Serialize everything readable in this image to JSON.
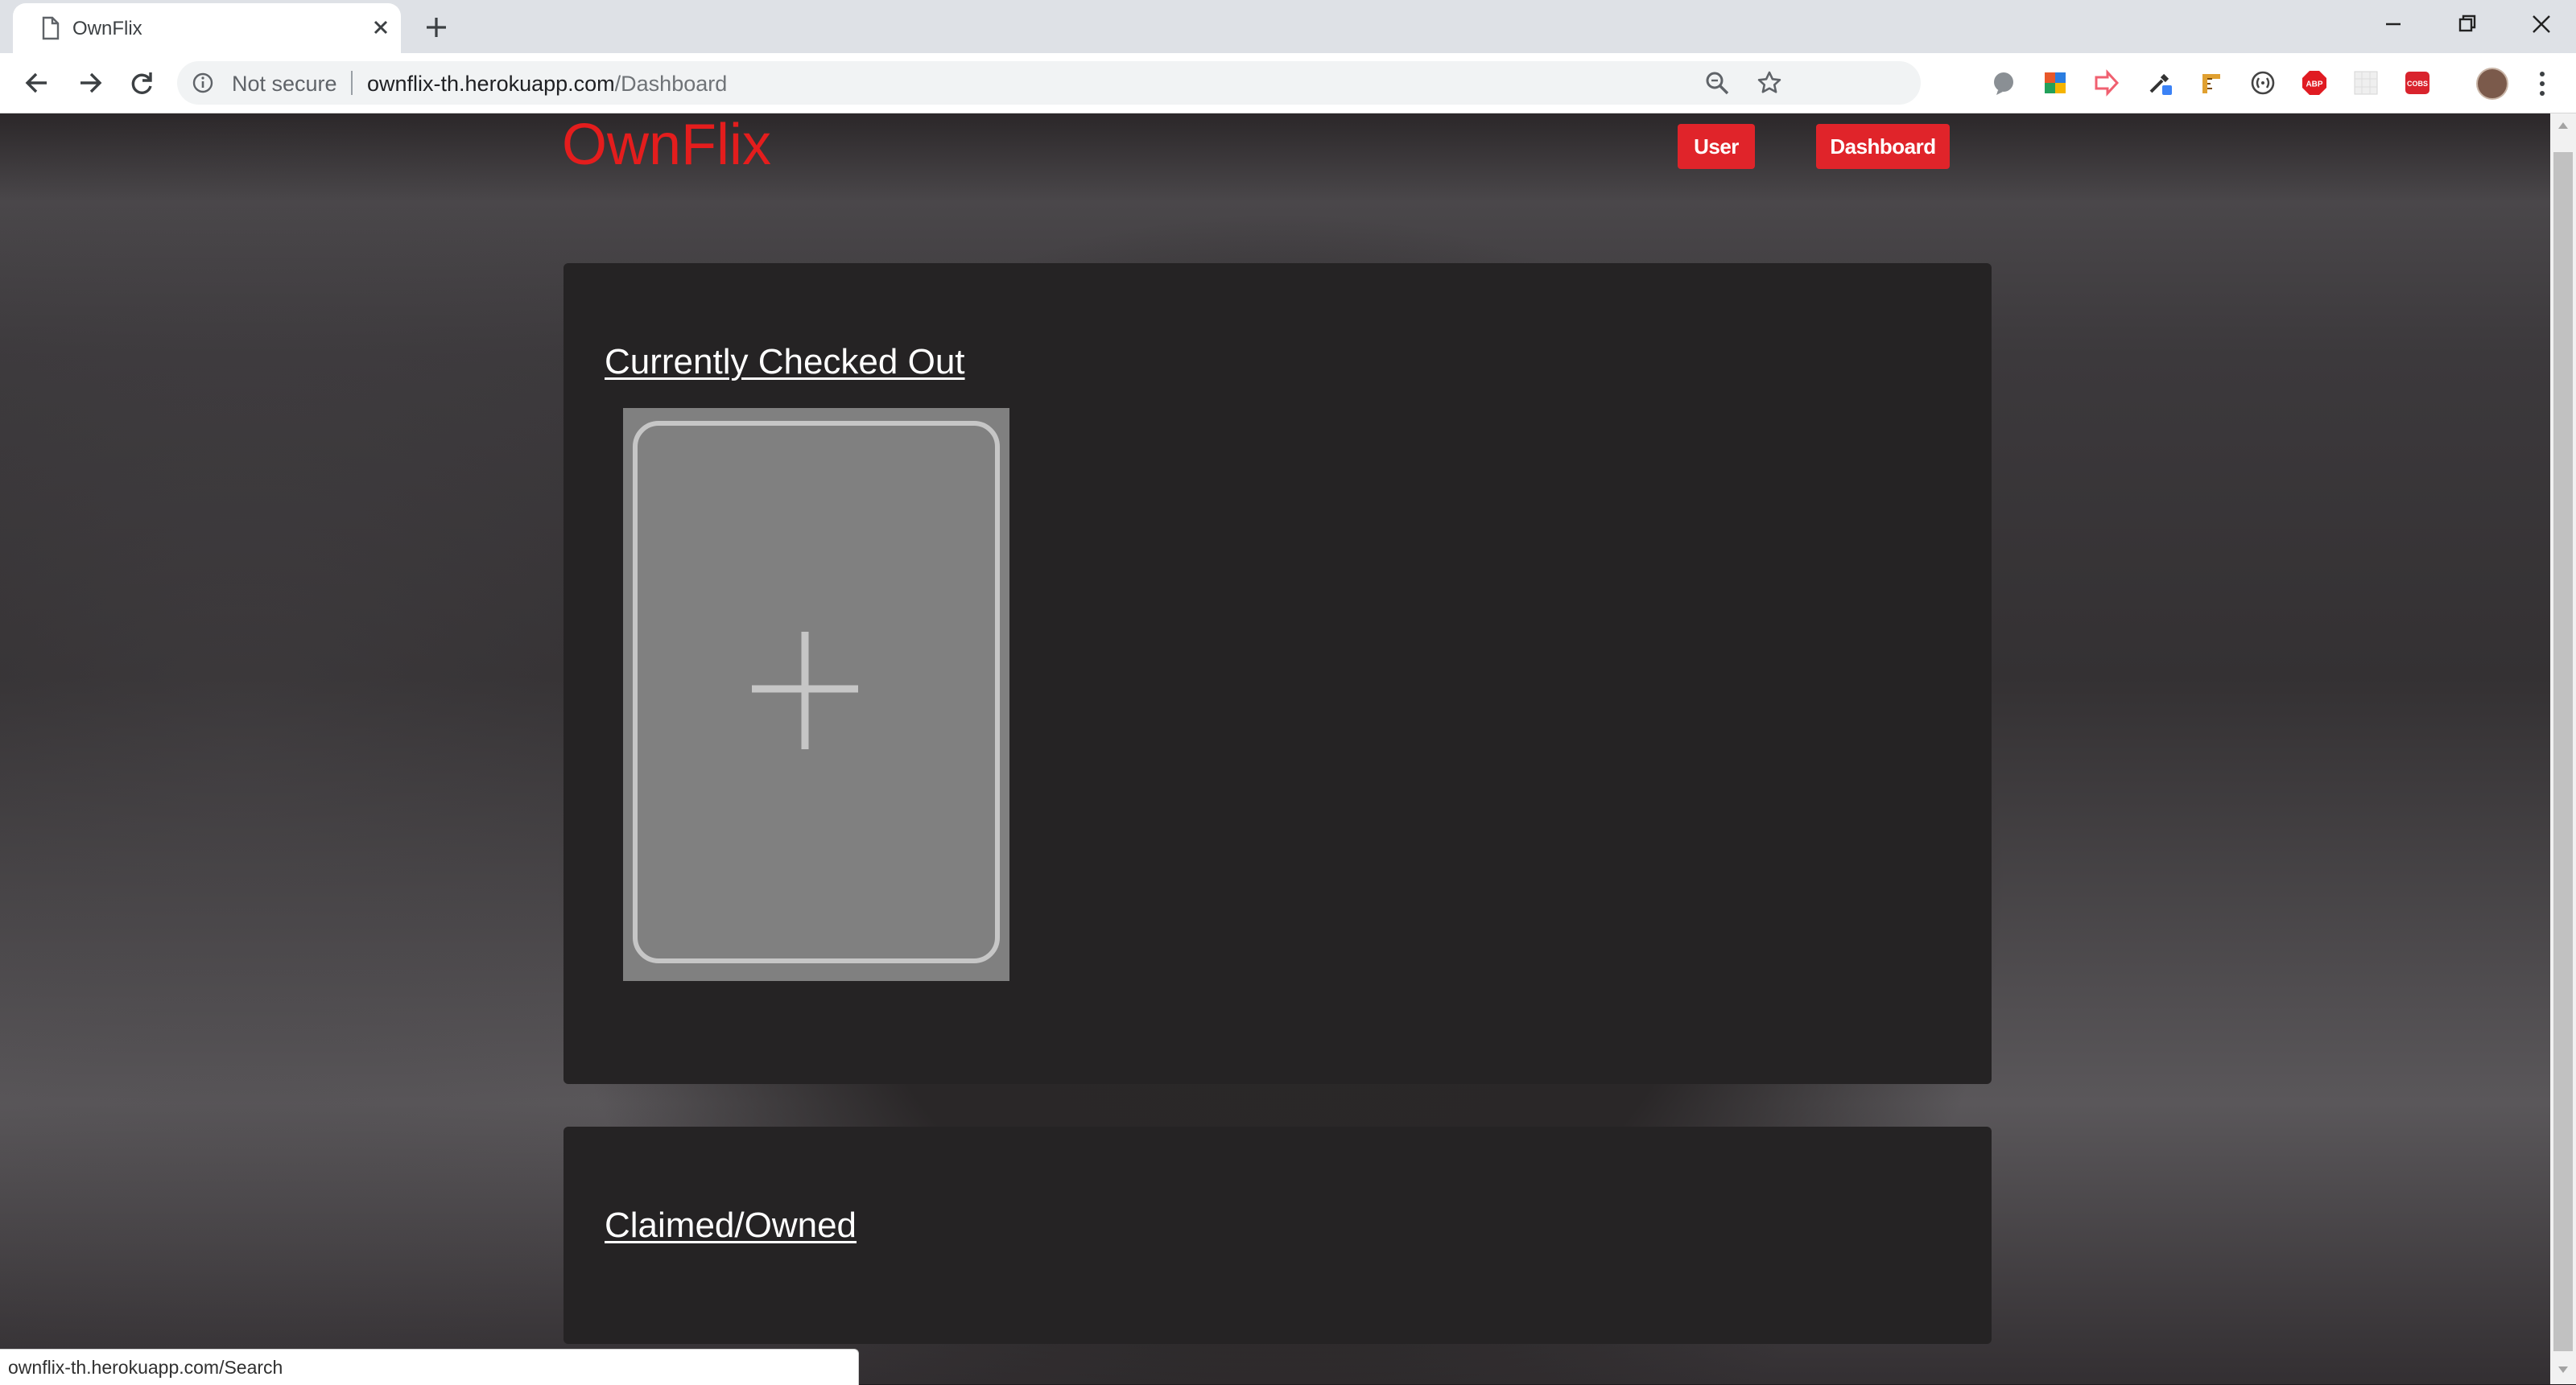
{
  "browser": {
    "tab_title": "OwnFlix",
    "security_label": "Not secure",
    "url_host": "ownflix-th.herokuapp.com",
    "url_path": "/Dashboard",
    "extensions": [
      {
        "name": "circle-ext-icon",
        "badge": ""
      },
      {
        "name": "colorful-ext-icon",
        "badge": ""
      },
      {
        "name": "arrow-ext-icon",
        "badge": ""
      },
      {
        "name": "eyedropper-ext-icon",
        "badge": ""
      },
      {
        "name": "ruler-ext-icon",
        "badge": ""
      },
      {
        "name": "code-ext-icon",
        "badge": "(·)"
      },
      {
        "name": "adblock-ext-icon",
        "badge": "ABP"
      },
      {
        "name": "grid-ext-icon",
        "badge": ""
      },
      {
        "name": "cobs-ext-icon",
        "badge": "COBS"
      }
    ]
  },
  "header": {
    "brand": "OwnFlix",
    "nav": [
      {
        "label": "User"
      },
      {
        "label": "Dashboard"
      }
    ]
  },
  "sections": {
    "checked_out": {
      "title": "Currently Checked Out"
    },
    "claimed": {
      "title": "Claimed/Owned"
    }
  },
  "status_bar": {
    "link_preview": "ownflix-th.herokuapp.com/Search"
  },
  "colors": {
    "brand_red": "#e41d1d",
    "button_red": "#e0242a",
    "panel": "#252324"
  }
}
